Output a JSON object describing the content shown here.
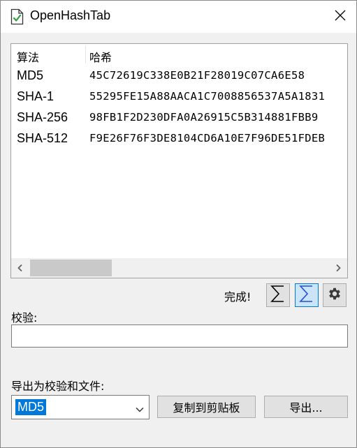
{
  "window": {
    "title": "OpenHashTab"
  },
  "hash_list": {
    "columns": [
      "算法",
      "哈希"
    ],
    "rows": [
      {
        "algorithm": "MD5",
        "hash": "45C72619C338E0B21F28019C07CA6E58"
      },
      {
        "algorithm": "SHA-1",
        "hash": "55295FE15A88AACA1C7008856537A5A1831"
      },
      {
        "algorithm": "SHA-256",
        "hash": "98FB1F2D230DFA0A26915C5B314881FBB9"
      },
      {
        "algorithm": "SHA-512",
        "hash": "F9E26F76F3DE8104CD6A10E7F96DE51FDEB"
      }
    ]
  },
  "status": {
    "text": "完成!"
  },
  "verify": {
    "label": "校验:",
    "value": "",
    "placeholder": ""
  },
  "export": {
    "label": "导出为校验和文件:",
    "selected_algorithm": "MD5",
    "copy_button": "复制到剪贴板",
    "export_button": "导出..."
  },
  "colors": {
    "accent": "#0078d7",
    "window_bg": "#f0f0f0",
    "icon_green": "#2e9e3e"
  },
  "icons": {
    "app": "document-check-icon",
    "close": "close-icon",
    "sum": "sigma-icon",
    "sum_alt": "sigma-blue-icon",
    "settings": "gear-icon",
    "dropdown": "chevron-down-icon"
  }
}
